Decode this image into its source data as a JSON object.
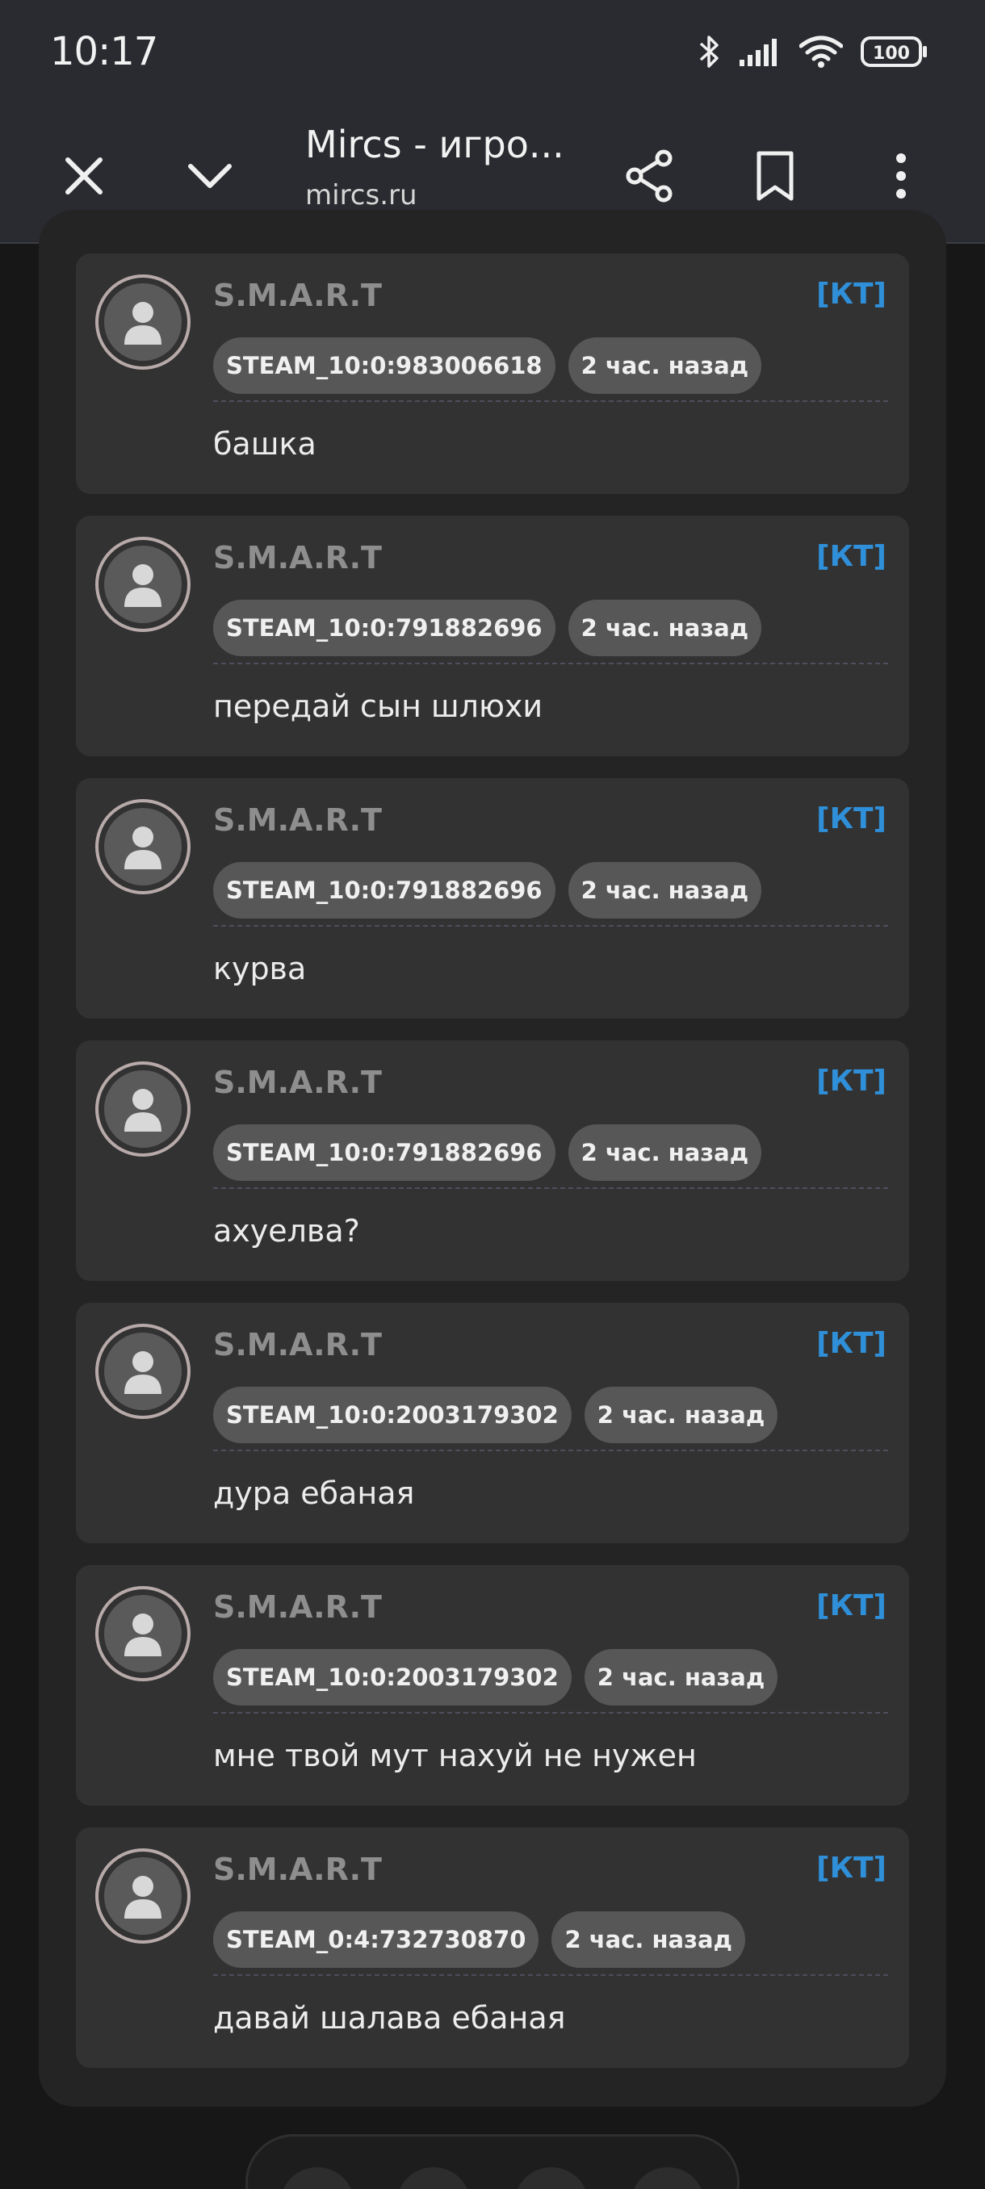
{
  "status_bar": {
    "time": "10:17",
    "battery": "100",
    "icons": [
      "bluetooth-icon",
      "signal-icon",
      "wifi-icon",
      "battery-icon"
    ]
  },
  "toolbar": {
    "title": "Mircs - игро...",
    "url": "mircs.ru",
    "icons": [
      "close-icon",
      "chevron-down-icon",
      "share-icon",
      "bookmark-icon",
      "more-vert-icon"
    ]
  },
  "colors": {
    "accent_team": "#2f8fd8",
    "nick": "#8e8e8e",
    "card": "#323232",
    "chip": "#575757"
  },
  "posts": [
    {
      "nick": "S.M.A.R.T",
      "team": "[КТ]",
      "steam_id": "STEAM_10:0:983006618",
      "time": "2 час. назад",
      "text": "башка"
    },
    {
      "nick": "S.M.A.R.T",
      "team": "[КТ]",
      "steam_id": "STEAM_10:0:791882696",
      "time": "2 час. назад",
      "text": "передай сын шлюхи"
    },
    {
      "nick": "S.M.A.R.T",
      "team": "[КТ]",
      "steam_id": "STEAM_10:0:791882696",
      "time": "2 час. назад",
      "text": "курва"
    },
    {
      "nick": "S.M.A.R.T",
      "team": "[КТ]",
      "steam_id": "STEAM_10:0:791882696",
      "time": "2 час. назад",
      "text": "ахуелва?"
    },
    {
      "nick": "S.M.A.R.T",
      "team": "[КТ]",
      "steam_id": "STEAM_10:0:2003179302",
      "time": "2 час. назад",
      "text": "дура ебаная"
    },
    {
      "nick": "S.M.A.R.T",
      "team": "[КТ]",
      "steam_id": "STEAM_10:0:2003179302",
      "time": "2 час. назад",
      "text": "мне твой мут нахуй не нужен"
    },
    {
      "nick": "S.M.A.R.T",
      "team": "[КТ]",
      "steam_id": "STEAM_0:4:732730870",
      "time": "2 час. назад",
      "text": "давай шалава ебаная"
    }
  ]
}
